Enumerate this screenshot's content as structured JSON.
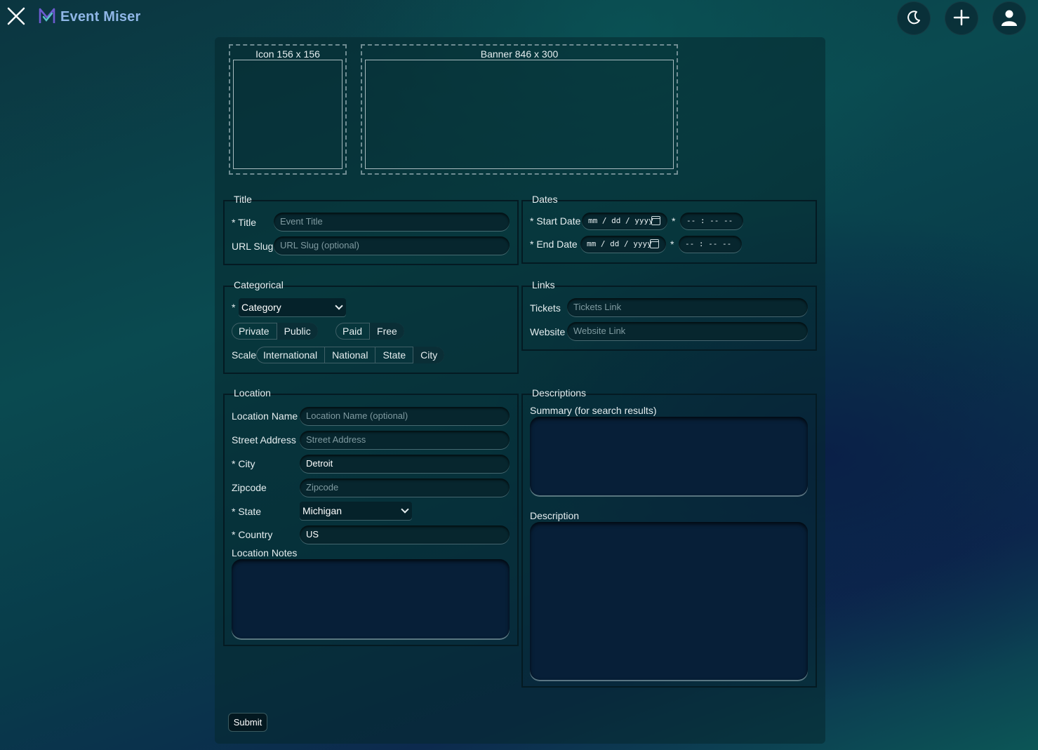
{
  "app": {
    "name": "Event Miser"
  },
  "header": {
    "icons": [
      "close-icon",
      "logo-icon",
      "moon-icon",
      "plus-icon",
      "user-icon"
    ]
  },
  "media": {
    "icon_label": "Icon 156 x 156",
    "banner_label": "Banner 846 x 300"
  },
  "title_group": {
    "legend": "Title",
    "title_label": "* Title",
    "title_placeholder": "Event Title",
    "slug_label": "URL Slug",
    "slug_placeholder": "URL Slug (optional)"
  },
  "dates_group": {
    "legend": "Dates",
    "start_label": "* Start Date",
    "end_label": "* End Date",
    "date_placeholder": "mm / dd / yyyy",
    "time_star": "*",
    "time_placeholder": "-- : --  --"
  },
  "categorical_group": {
    "legend": "Categorical",
    "category_star": "*",
    "category_value": "Category",
    "visibility": [
      "Private",
      "Public"
    ],
    "visibility_selected": "Public",
    "pricing": [
      "Paid",
      "Free"
    ],
    "pricing_selected": "Free",
    "scale_label": "Scale",
    "scale_options": [
      "International",
      "National",
      "State",
      "City"
    ],
    "scale_selected": "City"
  },
  "links_group": {
    "legend": "Links",
    "tickets_label": "Tickets",
    "tickets_placeholder": "Tickets Link",
    "website_label": "Website",
    "website_placeholder": "Website Link"
  },
  "location_group": {
    "legend": "Location",
    "name_label": "Location Name",
    "name_placeholder": "Location Name (optional)",
    "street_label": "Street Address",
    "street_placeholder": "Street Address",
    "city_label": "* City",
    "city_value": "Detroit",
    "zip_label": "Zipcode",
    "zip_placeholder": "Zipcode",
    "state_label": "* State",
    "state_value": "Michigan",
    "country_label": "* Country",
    "country_value": "US",
    "notes_label": "Location Notes"
  },
  "descriptions_group": {
    "legend": "Descriptions",
    "summary_label": "Summary (for search results)",
    "description_label": "Description"
  },
  "submit_label": "Submit"
}
